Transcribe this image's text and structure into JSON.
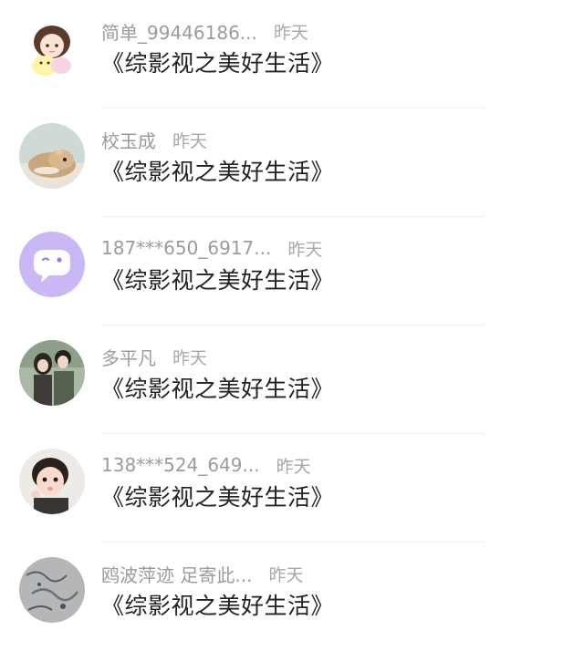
{
  "comments": [
    {
      "username": "简单_99446186...",
      "time": "昨天",
      "message": "《综影视之美好生活》",
      "avatar": "anime-girl-avatar"
    },
    {
      "username": "校玉成",
      "time": "昨天",
      "message": "《综影视之美好生活》",
      "avatar": "hamster-avatar"
    },
    {
      "username": "187***650_6917...",
      "time": "昨天",
      "message": "《综影视之美好生活》",
      "avatar": "chat-bubble-avatar"
    },
    {
      "username": "多平凡",
      "time": "昨天",
      "message": "《综影视之美好生活》",
      "avatar": "couple-photo-avatar"
    },
    {
      "username": "138***524_649...",
      "time": "昨天",
      "message": "《综影视之美好生活》",
      "avatar": "child-photo-avatar"
    },
    {
      "username": "鸥波萍迹 足寄此...",
      "time": "昨天",
      "message": "《综影视之美好生活》",
      "avatar": "ink-painting-avatar"
    }
  ],
  "colors": {
    "username": "#9b9b9b",
    "time": "#a8a8a8",
    "message": "#222222",
    "divider": "#efefef",
    "chat_avatar_bg": "#c9b8f5"
  }
}
